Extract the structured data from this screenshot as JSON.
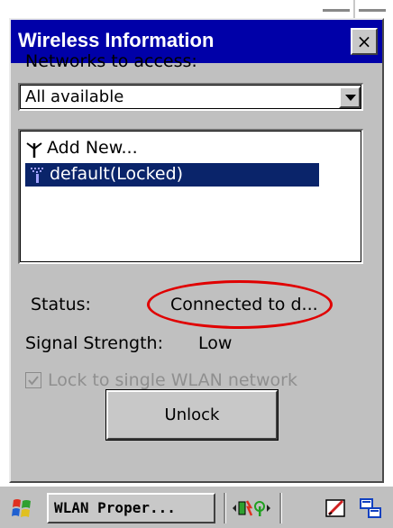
{
  "window": {
    "title": "Wireless Information",
    "close_label": "×"
  },
  "networks": {
    "label": "Networks to access:",
    "selected": "All available"
  },
  "network_list": [
    {
      "label": "Add New..."
    },
    {
      "label": "default(Locked)",
      "selected": true
    }
  ],
  "status": {
    "label": "Status:",
    "value": "Connected to d..."
  },
  "signal": {
    "label": "Signal Strength:",
    "value": "Low"
  },
  "lock": {
    "label": "Lock to single WLAN network",
    "checked": true,
    "disabled": true
  },
  "unlock_button": {
    "label": "Unlock"
  },
  "taskbar": {
    "task_label": "WLAN Proper..."
  },
  "icons": {
    "start": "windows-start-icon",
    "antenna": "antenna-icon",
    "wireless_signal": "wireless-signal-icon",
    "status": "wifi-status-icon",
    "input_panel": "pen-input-icon",
    "network": "network-icon"
  },
  "colors": {
    "title_bar": "#0000a8",
    "selection": "#0a246a",
    "annotation": "#e00000"
  }
}
